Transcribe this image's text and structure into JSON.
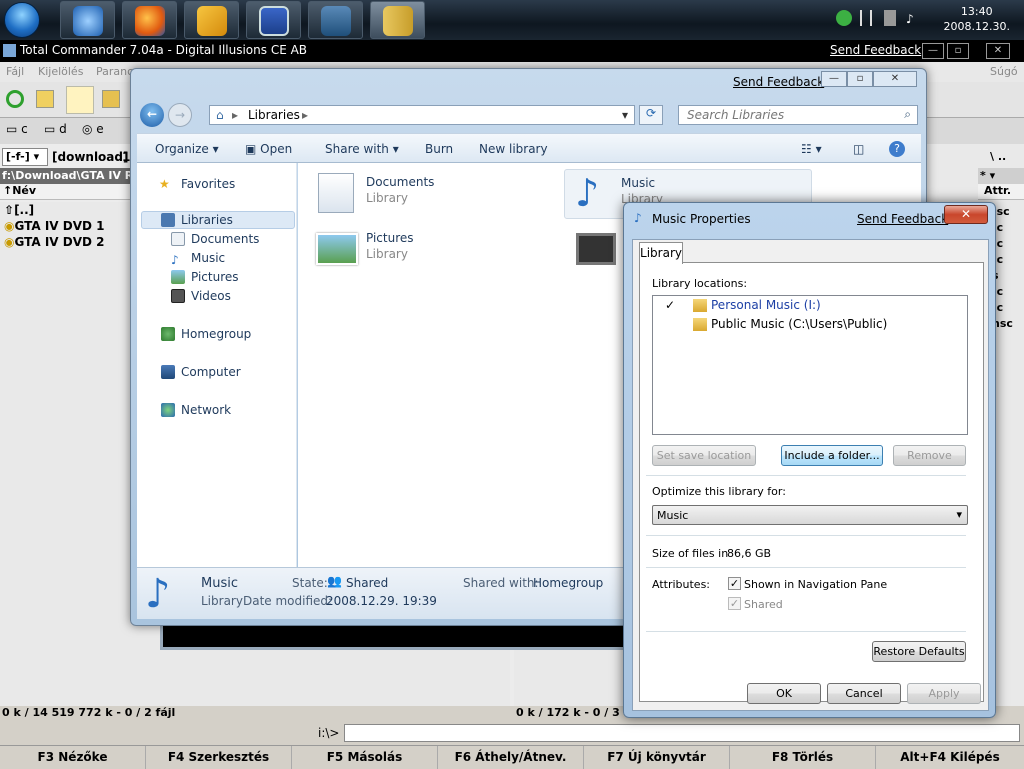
{
  "taskbar": {
    "clock_time": "13:40",
    "clock_date": "2008.12.30."
  },
  "tc": {
    "title": "Total Commander 7.04a - Digital Illusions CE AB",
    "send_feedback": "Send Feedback",
    "menu": [
      "Fájl",
      "Kijelölés",
      "Parancs"
    ],
    "menu_right": "Súgó",
    "drives": [
      "c",
      "d",
      "e"
    ],
    "left_combo": "[-f-]",
    "left_label": "[download]",
    "left_free": "1",
    "left_path": "f:\\Download\\GTA IV R",
    "col_name": "↑Név",
    "col_attr": "Attr.",
    "files": [
      "[..]",
      "GTA IV DVD 1",
      "GTA IV DVD 2"
    ],
    "right_combo": "\\   ..",
    "right_star": "*",
    "attrs": [
      "-sc",
      "-c",
      "-c",
      "-c",
      "s",
      "-c",
      "-c",
      "nsc"
    ],
    "status_left": "0 k / 14 519 772 k - 0 / 2 fájl",
    "status_right": "0 k / 172 k - 0 / 3",
    "cmd_prompt": "i:\\>",
    "fkeys": [
      "F3 Nézőke",
      "F4 Szerkesztés",
      "F5 Másolás",
      "F6 Áthely/Átnev.",
      "F7 Új könyvtár",
      "F8 Törlés",
      "Alt+F4 Kilépés"
    ]
  },
  "explorer": {
    "send_feedback": "Send Feedback",
    "address": "Libraries",
    "search_placeholder": "Search Libraries",
    "toolbar": {
      "organize": "Organize",
      "open": "Open",
      "share_with": "Share with",
      "burn": "Burn",
      "new_library": "New library"
    },
    "nav": {
      "favorites": "Favorites",
      "libraries": "Libraries",
      "documents": "Documents",
      "music": "Music",
      "pictures": "Pictures",
      "videos": "Videos",
      "homegroup": "Homegroup",
      "computer": "Computer",
      "network": "Network"
    },
    "libraries": [
      {
        "name": "Documents",
        "type": "Library"
      },
      {
        "name": "Music",
        "type": "Library"
      },
      {
        "name": "Pictures",
        "type": "Library"
      }
    ],
    "details": {
      "name": "Music",
      "type": "Library",
      "state_label": "State:",
      "state_value": "Shared",
      "modified_label": "Date modified:",
      "modified_value": "2008.12.29. 19:39",
      "shared_label": "Shared with:",
      "shared_value": "Homegroup"
    }
  },
  "dialog": {
    "title": "Music Properties",
    "send_feedback": "Send Feedback",
    "tab": "Library",
    "locations_label": "Library locations:",
    "locations": [
      {
        "check": "✓",
        "name": "Personal Music (I:)"
      },
      {
        "check": "",
        "name": "Public Music (C:\\Users\\Public)"
      }
    ],
    "set_save": "Set save location",
    "include_folder": "Include a folder...",
    "remove": "Remove",
    "optimize_label": "Optimize this library for:",
    "optimize_value": "Music",
    "size_label": "Size of files in",
    "size_value": "86,6 GB",
    "attributes_label": "Attributes:",
    "attr_nav": "Shown in Navigation Pane",
    "attr_shared": "Shared",
    "restore": "Restore Defaults",
    "ok": "OK",
    "cancel": "Cancel",
    "apply": "Apply"
  }
}
